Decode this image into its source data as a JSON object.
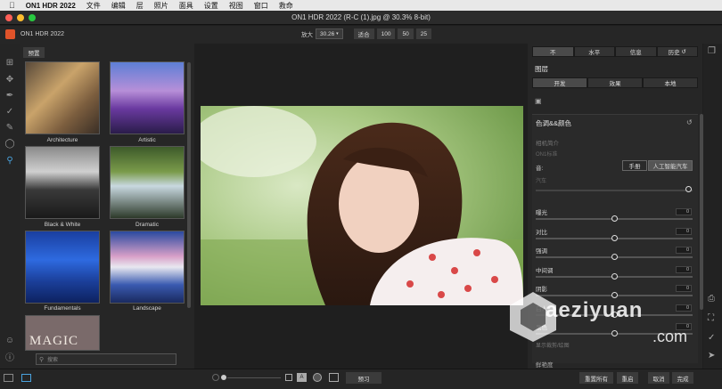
{
  "menubar": {
    "app": "ON1 HDR 2022",
    "items": [
      "文件",
      "编辑",
      "层",
      "照片",
      "面具",
      "设置",
      "视图",
      "窗口",
      "救命"
    ]
  },
  "window": {
    "title": "ON1 HDR 2022 (R-C (1).jpg @ 30.3% 8-bit)"
  },
  "appbar": {
    "app_name": "ON1 HDR 2022",
    "zoom_label": "放大",
    "zoom_value": "30.26",
    "fit_label": "适合",
    "zoom_presets": [
      "100",
      "50",
      "25"
    ]
  },
  "left": {
    "preset_tab": "预置",
    "thumbs": [
      {
        "label": "Architecture"
      },
      {
        "label": "Artistic"
      },
      {
        "label": "Black & White"
      },
      {
        "label": "Dramatic"
      },
      {
        "label": "Fundamentals"
      },
      {
        "label": "Landscape"
      },
      {
        "label": "MAGIC"
      }
    ],
    "search_placeholder": "搜索"
  },
  "right": {
    "tabs": [
      "不",
      "水平",
      "信息",
      "历史"
    ],
    "layers_title": "图层",
    "subtabs": [
      "开发",
      "效果",
      "本地"
    ],
    "section_title": "色调&&颜色",
    "preset_label": "相机简介",
    "preset_value": "ON1标准",
    "mode_label": "音:",
    "mode_manual": "手册",
    "mode_ai": "人工智能汽车",
    "auto_label": "汽车",
    "sliders": [
      {
        "label": "曝光",
        "value": "0",
        "pos": 0.5
      },
      {
        "label": "对比",
        "value": "0",
        "pos": 0.5
      },
      {
        "label": "强调",
        "value": "0",
        "pos": 0.5
      },
      {
        "label": "中间调",
        "value": "0",
        "pos": 0.5
      },
      {
        "label": "阴影",
        "value": "0",
        "pos": 0.5
      },
      {
        "label": "白人",
        "value": "0",
        "pos": 0.5
      },
      {
        "label": "黑色",
        "value": "0",
        "pos": 0.5
      }
    ],
    "hint": "显示裁剪/绘图",
    "bottom_label": "鲜艳度"
  },
  "bottom": {
    "preview": "预习",
    "reset_all": "重置所有",
    "reset": "重启",
    "cancel": "取消",
    "done": "完成"
  },
  "watermark": {
    "text": "aeziyuan",
    "suffix": ".com"
  },
  "colors": {
    "accent": "#e0532a",
    "bg": "#1e1e1e",
    "panel": "#262626"
  }
}
